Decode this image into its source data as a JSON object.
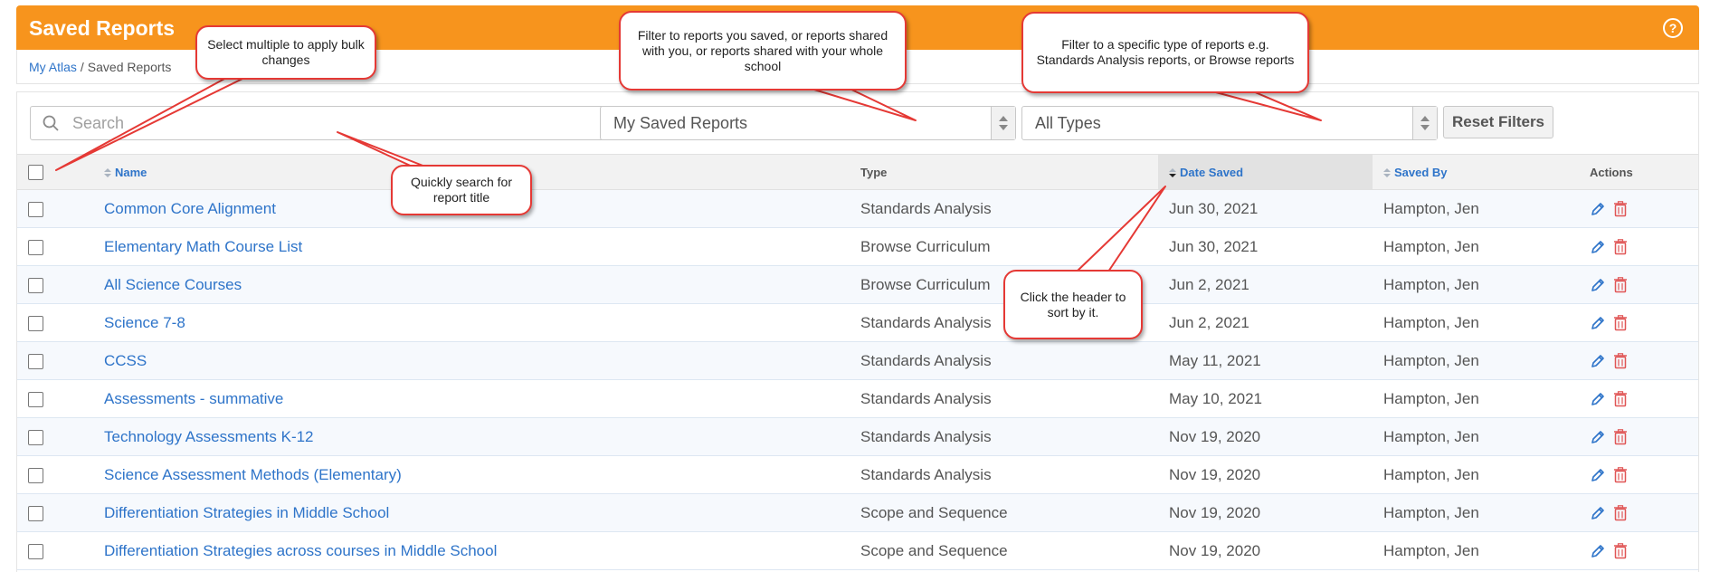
{
  "header": {
    "title": "Saved Reports",
    "help_icon": "?"
  },
  "breadcrumb": {
    "parent": "My Atlas",
    "separator": "/",
    "current": "Saved Reports"
  },
  "filters": {
    "search_placeholder": "Search",
    "ownership": "My Saved Reports",
    "type": "All Types",
    "reset_label": "Reset Filters"
  },
  "table": {
    "columns": {
      "name": "Name",
      "type": "Type",
      "date": "Date Saved",
      "saved_by": "Saved By",
      "actions": "Actions"
    },
    "sorted_column": "Date Saved",
    "rows": [
      {
        "name": "Common Core Alignment",
        "type": "Standards Analysis",
        "date": "Jun 30, 2021",
        "saved_by": "Hampton, Jen"
      },
      {
        "name": "Elementary Math Course List",
        "type": "Browse Curriculum",
        "date": "Jun 30, 2021",
        "saved_by": "Hampton, Jen"
      },
      {
        "name": "All Science Courses",
        "type": "Browse Curriculum",
        "date": "Jun 2, 2021",
        "saved_by": "Hampton, Jen"
      },
      {
        "name": "Science 7-8",
        "type": "Standards Analysis",
        "date": "Jun 2, 2021",
        "saved_by": "Hampton, Jen"
      },
      {
        "name": "CCSS",
        "type": "Standards Analysis",
        "date": "May 11, 2021",
        "saved_by": "Hampton, Jen"
      },
      {
        "name": "Assessments - summative",
        "type": "Standards Analysis",
        "date": "May 10, 2021",
        "saved_by": "Hampton, Jen"
      },
      {
        "name": "Technology Assessments K-12",
        "type": "Standards Analysis",
        "date": "Nov 19, 2020",
        "saved_by": "Hampton, Jen"
      },
      {
        "name": "Science Assessment Methods (Elementary)",
        "type": "Standards Analysis",
        "date": "Nov 19, 2020",
        "saved_by": "Hampton, Jen"
      },
      {
        "name": "Differentiation Strategies in Middle School",
        "type": "Scope and Sequence",
        "date": "Nov 19, 2020",
        "saved_by": "Hampton, Jen"
      },
      {
        "name": "Differentiation Strategies across courses in Middle School",
        "type": "Scope and Sequence",
        "date": "Nov 19, 2020",
        "saved_by": "Hampton, Jen"
      }
    ]
  },
  "callouts": {
    "bulk": "Select multiple to apply bulk changes",
    "search": "Quickly search for report title",
    "ownership": "Filter to reports you saved, or reports shared with you, or reports shared with your whole school",
    "type": "Filter to a specific type of reports e.g. Standards Analysis reports, or Browse reports",
    "sort": "Click the header to sort by it."
  },
  "colors": {
    "brand": "#f7941d",
    "link": "#2e74c9",
    "delete": "#e05555",
    "callout_border": "#e53935"
  }
}
